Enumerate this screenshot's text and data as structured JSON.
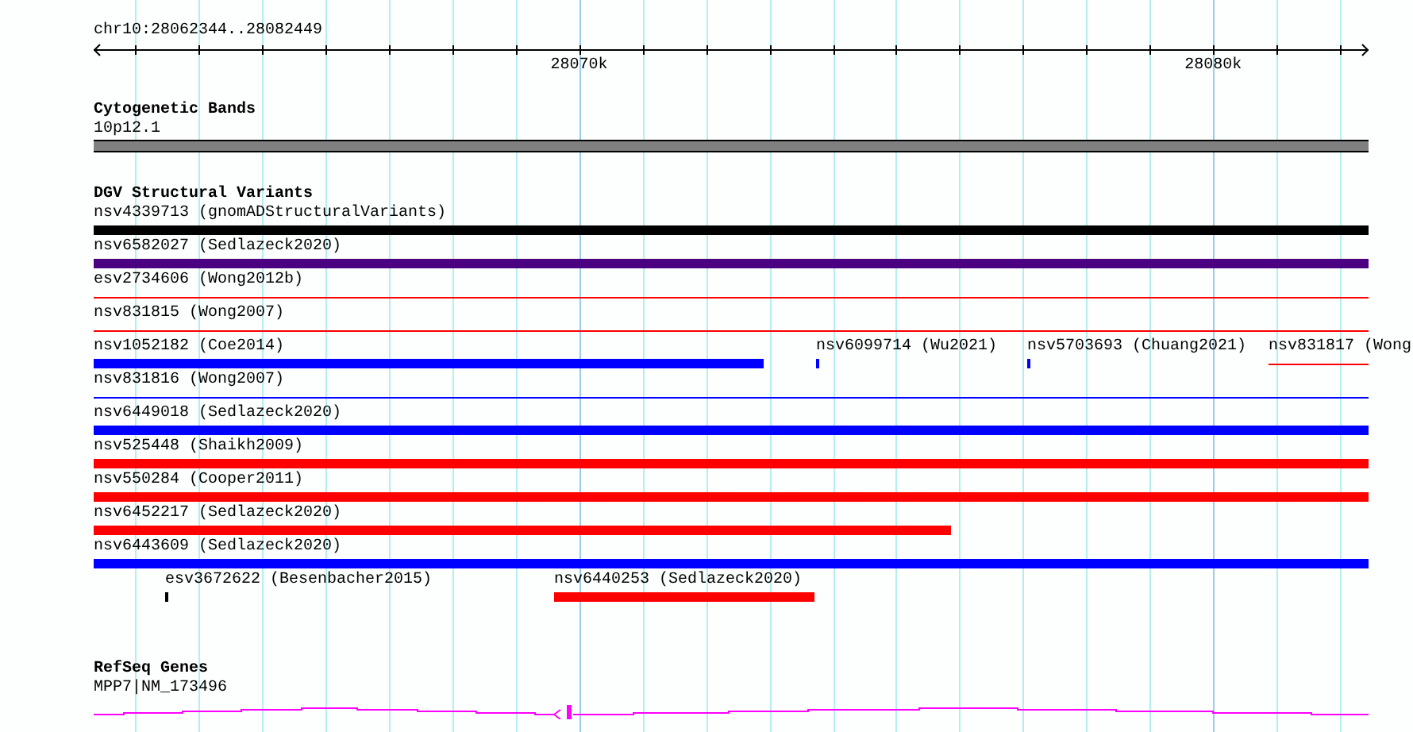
{
  "ruler": {
    "location": "chr10:28062344..28082449",
    "tick_labels": [
      "28070k",
      "28080k"
    ]
  },
  "tracks": [
    {
      "kind": "cytoband",
      "title": "Cytogenetic Bands",
      "features": [
        {
          "label": "10p12.1"
        }
      ]
    },
    {
      "kind": "variants",
      "title": "DGV Structural Variants",
      "rows": [
        {
          "features": [
            {
              "label": "nsv4339713 (gnomADStructuralVariants)",
              "color": "#000000",
              "kind": "thick"
            }
          ]
        },
        {
          "features": [
            {
              "label": "nsv6582027 (Sedlazeck2020)",
              "color": "#4b0082",
              "kind": "thick"
            }
          ]
        },
        {
          "features": [
            {
              "label": "esv2734606 (Wong2012b)",
              "color": "#ff0000",
              "kind": "thin"
            }
          ]
        },
        {
          "features": [
            {
              "label": "nsv831815 (Wong2007)",
              "color": "#ff0000",
              "kind": "thin"
            }
          ]
        },
        {
          "features": [
            {
              "label": "nsv1052182 (Coe2014)",
              "color": "#0000ff",
              "kind": "thick"
            },
            {
              "label": "nsv6099714 (Wu2021)",
              "color": "#0000ff",
              "kind": "thick"
            },
            {
              "label": "nsv5703693 (Chuang2021)",
              "color": "#0000ff",
              "kind": "thick"
            },
            {
              "label": "nsv831817 (Wong",
              "color": "#ff0000",
              "kind": "thin"
            }
          ]
        },
        {
          "features": [
            {
              "label": "nsv831816 (Wong2007)",
              "color": "#0000ff",
              "kind": "thin"
            }
          ]
        },
        {
          "features": [
            {
              "label": "nsv6449018 (Sedlazeck2020)",
              "color": "#0000ff",
              "kind": "thick"
            }
          ]
        },
        {
          "features": [
            {
              "label": "nsv525448 (Shaikh2009)",
              "color": "#ff0000",
              "kind": "thick"
            }
          ]
        },
        {
          "features": [
            {
              "label": "nsv550284 (Cooper2011)",
              "color": "#ff0000",
              "kind": "thick"
            }
          ]
        },
        {
          "features": [
            {
              "label": "nsv6452217 (Sedlazeck2020)",
              "color": "#ff0000",
              "kind": "thick"
            }
          ]
        },
        {
          "features": [
            {
              "label": "nsv6443609 (Sedlazeck2020)",
              "color": "#0000ff",
              "kind": "thick"
            }
          ]
        },
        {
          "features": [
            {
              "label": "esv3672622 (Besenbacher2015)",
              "color": "#000000",
              "kind": "thick"
            },
            {
              "label": "nsv6440253 (Sedlazeck2020)",
              "color": "#ff0000",
              "kind": "thick"
            }
          ]
        }
      ]
    },
    {
      "kind": "gene",
      "title": "RefSeq Genes",
      "features": [
        {
          "label": "MPP7|NM_173496"
        }
      ]
    }
  ]
}
